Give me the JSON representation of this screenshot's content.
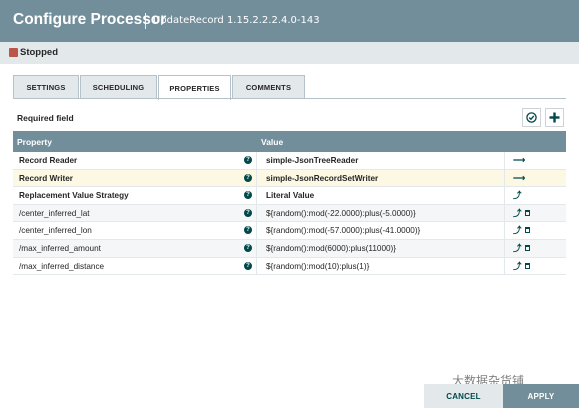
{
  "dialog": {
    "title": "Configure Processor",
    "subtitle": "UpdateRecord 1.15.2.2.2.4.0-143"
  },
  "status": {
    "text": "Stopped",
    "color": "#ba554a"
  },
  "tabs": [
    {
      "label": "SETTINGS",
      "active": false
    },
    {
      "label": "SCHEDULING",
      "active": false
    },
    {
      "label": "PROPERTIES",
      "active": true
    },
    {
      "label": "COMMENTS",
      "active": false
    }
  ],
  "required_label": "Required field",
  "toolbar": {
    "verify_icon": "check-circle-icon",
    "add_icon": "plus-icon"
  },
  "grid": {
    "headers": {
      "property": "Property",
      "value": "Value"
    },
    "rows": [
      {
        "name": "Record Reader",
        "value": "simple-JsonTreeReader",
        "required": true,
        "action": "go-to-service-icon",
        "deletable": false
      },
      {
        "name": "Record Writer",
        "value": "simple-JsonRecordSetWriter",
        "required": true,
        "action": "go-to-service-icon",
        "deletable": false
      },
      {
        "name": "Replacement Value Strategy",
        "value": "Literal Value",
        "required": true,
        "action": "convert-to-parameter-icon",
        "deletable": false
      },
      {
        "name": "/center_inferred_lat",
        "value": "${random():mod(-22.0000):plus(-5.0000)}",
        "required": false,
        "action": "convert-to-parameter-icon",
        "deletable": true
      },
      {
        "name": "/center_inferred_lon",
        "value": "${random():mod(-57.0000):plus(-41.0000)}",
        "required": false,
        "action": "convert-to-parameter-icon",
        "deletable": true
      },
      {
        "name": "/max_inferred_amount",
        "value": "${random():mod(6000):plus(11000)}",
        "required": false,
        "action": "convert-to-parameter-icon",
        "deletable": true
      },
      {
        "name": "/max_inferred_distance",
        "value": "${random():mod(10):plus(1)}",
        "required": false,
        "action": "convert-to-parameter-icon",
        "deletable": true
      }
    ]
  },
  "footer": {
    "cancel_label": "CANCEL",
    "apply_label": "APPLY"
  },
  "watermark": "大数据杂货铺",
  "colors": {
    "header": "#728e9b",
    "accent": "#004849",
    "tab_bg": "#e3e8eb"
  }
}
